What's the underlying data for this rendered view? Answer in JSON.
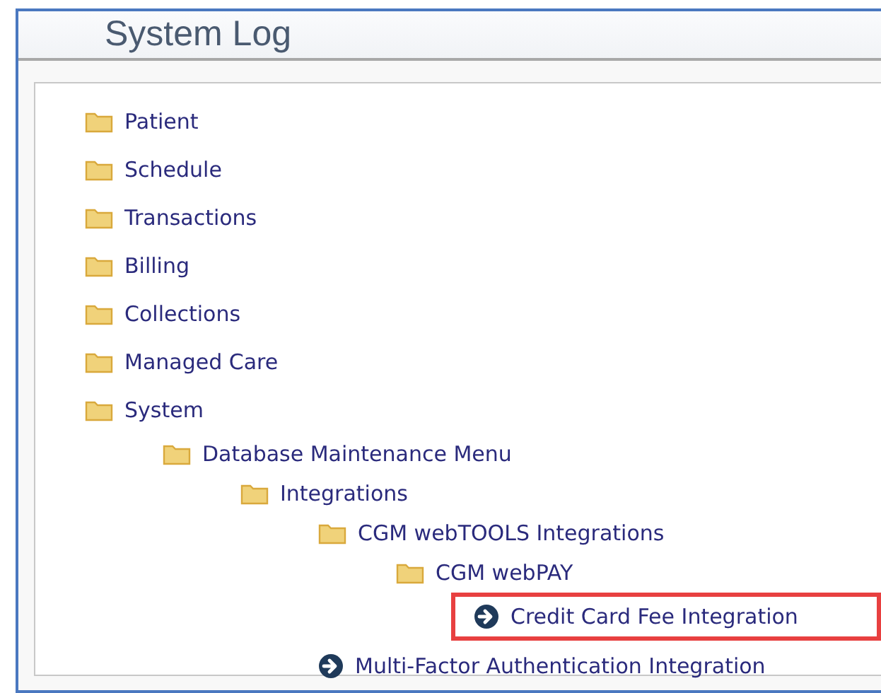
{
  "window": {
    "title": "System Log"
  },
  "tree": [
    {
      "label": "Patient",
      "kind": "folder",
      "highlighted": false
    },
    {
      "label": "Schedule",
      "kind": "folder",
      "highlighted": false
    },
    {
      "label": "Transactions",
      "kind": "folder",
      "highlighted": false
    },
    {
      "label": "Billing",
      "kind": "folder",
      "highlighted": false
    },
    {
      "label": "Collections",
      "kind": "folder",
      "highlighted": false
    },
    {
      "label": "Managed Care",
      "kind": "folder",
      "highlighted": false
    },
    {
      "label": "System",
      "kind": "folder",
      "highlighted": false,
      "children": [
        {
          "label": "Database Maintenance Menu",
          "kind": "folder",
          "highlighted": false,
          "children": [
            {
              "label": "Integrations",
              "kind": "folder",
              "highlighted": false,
              "children": [
                {
                  "label": "CGM webTOOLS Integrations",
                  "kind": "folder",
                  "highlighted": false,
                  "children": [
                    {
                      "label": "CGM webPAY",
                      "kind": "folder",
                      "highlighted": false,
                      "children": [
                        {
                          "label": "Credit Card Fee Integration",
                          "kind": "report",
                          "highlighted": true
                        }
                      ]
                    }
                  ]
                },
                {
                  "label": "Multi-Factor Authentication Integration",
                  "kind": "report",
                  "highlighted": false
                }
              ]
            }
          ]
        }
      ]
    }
  ]
}
